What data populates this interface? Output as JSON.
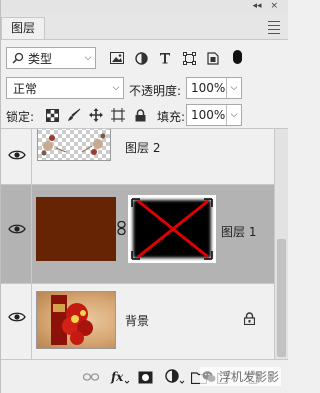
{
  "panel": {
    "tab_label": "图层",
    "collapse_glyph": "◂◂",
    "close_glyph": "×"
  },
  "filter": {
    "kind_label": "类型",
    "icons": [
      "image-filter-icon",
      "adjustment-filter-icon",
      "type-filter-icon",
      "shape-filter-icon",
      "smart-object-filter-icon"
    ]
  },
  "blend": {
    "mode": "正常",
    "opacity_label": "不透明度:",
    "opacity_value": "100%"
  },
  "lock": {
    "label": "锁定:",
    "fill_label": "填充:",
    "fill_value": "100%"
  },
  "layers": [
    {
      "name": "图层 2",
      "visible": true,
      "selected": false
    },
    {
      "name": "图层 1",
      "visible": true,
      "selected": true,
      "has_mask": true
    },
    {
      "name": "背景",
      "visible": true,
      "selected": false,
      "locked": true
    }
  ],
  "colors": {
    "selected_row": "#b3b3b3",
    "brown_fill": "#672405",
    "mask_cross": "#e00000"
  },
  "watermark": {
    "text": "浮机发影影"
  }
}
